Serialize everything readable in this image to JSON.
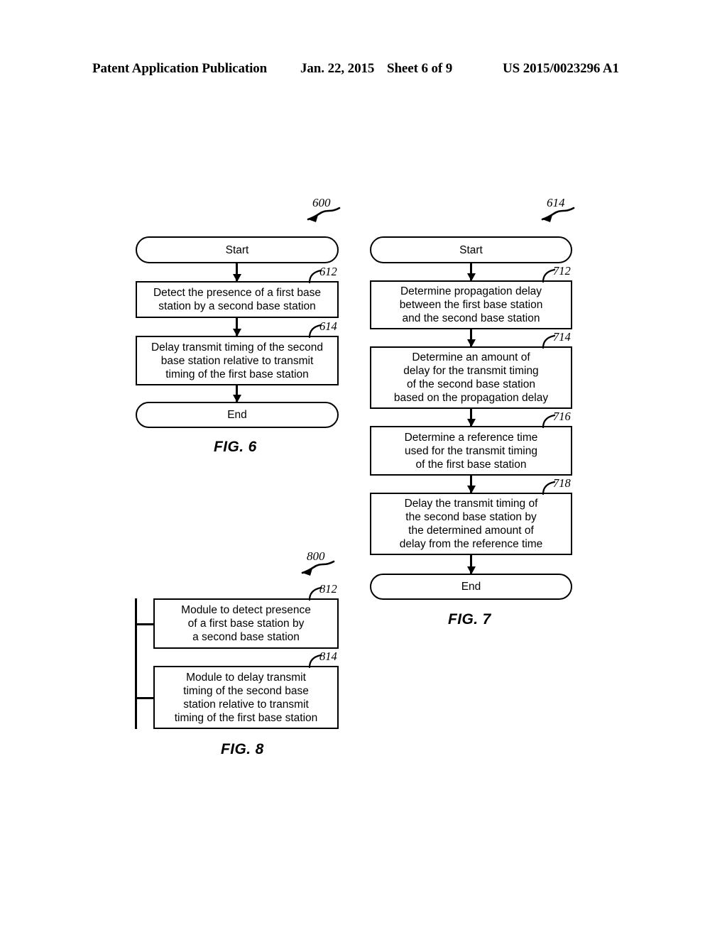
{
  "header": {
    "publication": "Patent Application Publication",
    "date": "Jan. 22, 2015",
    "sheet": "Sheet 6 of 9",
    "document_number": "US 2015/0023296 A1"
  },
  "figures": [
    {
      "id": "fig6",
      "caption": "FIG. 6",
      "title_ref": "600",
      "nodes": [
        {
          "ref": "",
          "shape": "pill",
          "text": "Start"
        },
        {
          "ref": "612",
          "shape": "rect",
          "text": "Detect the presence of a first base\nstation by a second base station"
        },
        {
          "ref": "614",
          "shape": "rect",
          "text": "Delay transmit timing of the second\nbase station relative to transmit\ntiming of the first base station"
        },
        {
          "ref": "",
          "shape": "pill",
          "text": "End"
        }
      ]
    },
    {
      "id": "fig7",
      "caption": "FIG. 7",
      "title_ref": "614",
      "nodes": [
        {
          "ref": "",
          "shape": "pill",
          "text": "Start"
        },
        {
          "ref": "712",
          "shape": "rect",
          "text": "Determine propagation delay\nbetween the first base station\nand the second base station"
        },
        {
          "ref": "714",
          "shape": "rect",
          "text": "Determine an amount of\ndelay for the transmit timing\nof the second base station\nbased on the propagation delay"
        },
        {
          "ref": "716",
          "shape": "rect",
          "text": "Determine a reference time\nused for the transmit timing\nof the first base station"
        },
        {
          "ref": "718",
          "shape": "rect",
          "text": "Delay the transmit timing of\nthe second base station by\nthe determined amount of\ndelay from the reference time"
        },
        {
          "ref": "",
          "shape": "pill",
          "text": "End"
        }
      ]
    },
    {
      "id": "fig8",
      "caption": "FIG. 8",
      "title_ref": "800",
      "nodes": [
        {
          "ref": "812",
          "shape": "rect",
          "text": "Module to detect presence\nof a first base station by\na second base station"
        },
        {
          "ref": "814",
          "shape": "rect",
          "text": "Module to delay transmit\ntiming of the second base\nstation relative to transmit\ntiming of the first base station"
        }
      ]
    }
  ],
  "colors": {
    "ink": "#000000",
    "paper": "#ffffff"
  }
}
